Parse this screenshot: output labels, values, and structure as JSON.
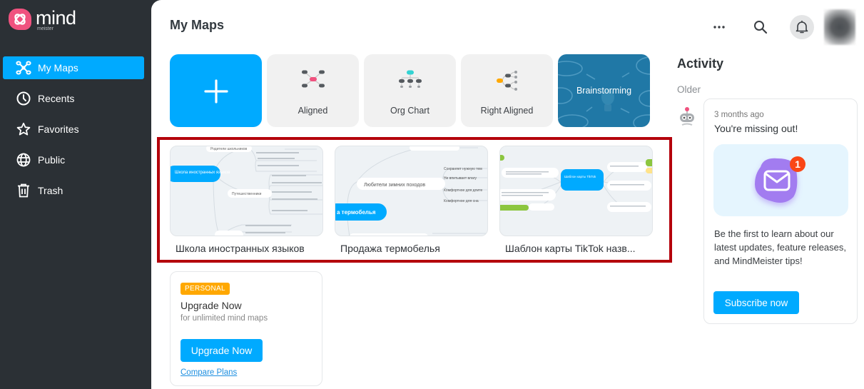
{
  "app": {
    "logo_word": "mind",
    "logo_sub": "meister"
  },
  "sidebar": {
    "items": [
      {
        "label": "My Maps",
        "icon": "mindmap-icon",
        "active": true
      },
      {
        "label": "Recents",
        "icon": "clock-icon"
      },
      {
        "label": "Favorites",
        "icon": "star-icon"
      },
      {
        "label": "Public",
        "icon": "globe-icon"
      },
      {
        "label": "Trash",
        "icon": "trash-icon"
      }
    ]
  },
  "header": {
    "title": "My Maps",
    "actions": [
      "more-icon",
      "search-icon",
      "bell-icon",
      "avatar"
    ]
  },
  "templates": [
    {
      "label": "",
      "icon": "plus-icon"
    },
    {
      "label": "Aligned",
      "icon": "aligned-layout-icon"
    },
    {
      "label": "Org Chart",
      "icon": "org-chart-icon"
    },
    {
      "label": "Right Aligned",
      "icon": "right-aligned-layout-icon"
    },
    {
      "label": "Brainstorming",
      "icon": "lightbulb-icon"
    }
  ],
  "maps": [
    {
      "name": "Школа иностранных языков",
      "root": "Школа иностранных языков",
      "nodes": [
        "Родители школьников",
        "Путешественники"
      ]
    },
    {
      "name": "Продажа термобелья",
      "root": "а термобелья",
      "nodes": [
        "Любители зимних походов",
        "Сохраняет нужную тем",
        "Не впитывает влагу",
        "Комфортное для длите",
        "Комфортное для сна"
      ]
    },
    {
      "name": "Шаблон карты TikTok    назв...",
      "root": "Шаблон карты TikTok"
    }
  ],
  "upgrade": {
    "badge": "PERSONAL",
    "title": "Upgrade Now",
    "subtitle": "for unlimited mind maps",
    "button": "Upgrade Now",
    "link": "Compare Plans"
  },
  "activity": {
    "title": "Activity",
    "section": "Older",
    "card": {
      "time": "3 months ago",
      "headline": "You're missing out!",
      "badge_count": "1",
      "body": "Be the first to learn about our latest updates, feature releases, and MindMeister tips!",
      "button": "Subscribe now"
    }
  },
  "colors": {
    "accent": "#00aaff",
    "sidebar_bg": "#2b3035",
    "brand_pink": "#f0527f",
    "badge_orange": "#ffa800",
    "highlight_red": "#b4000b"
  }
}
